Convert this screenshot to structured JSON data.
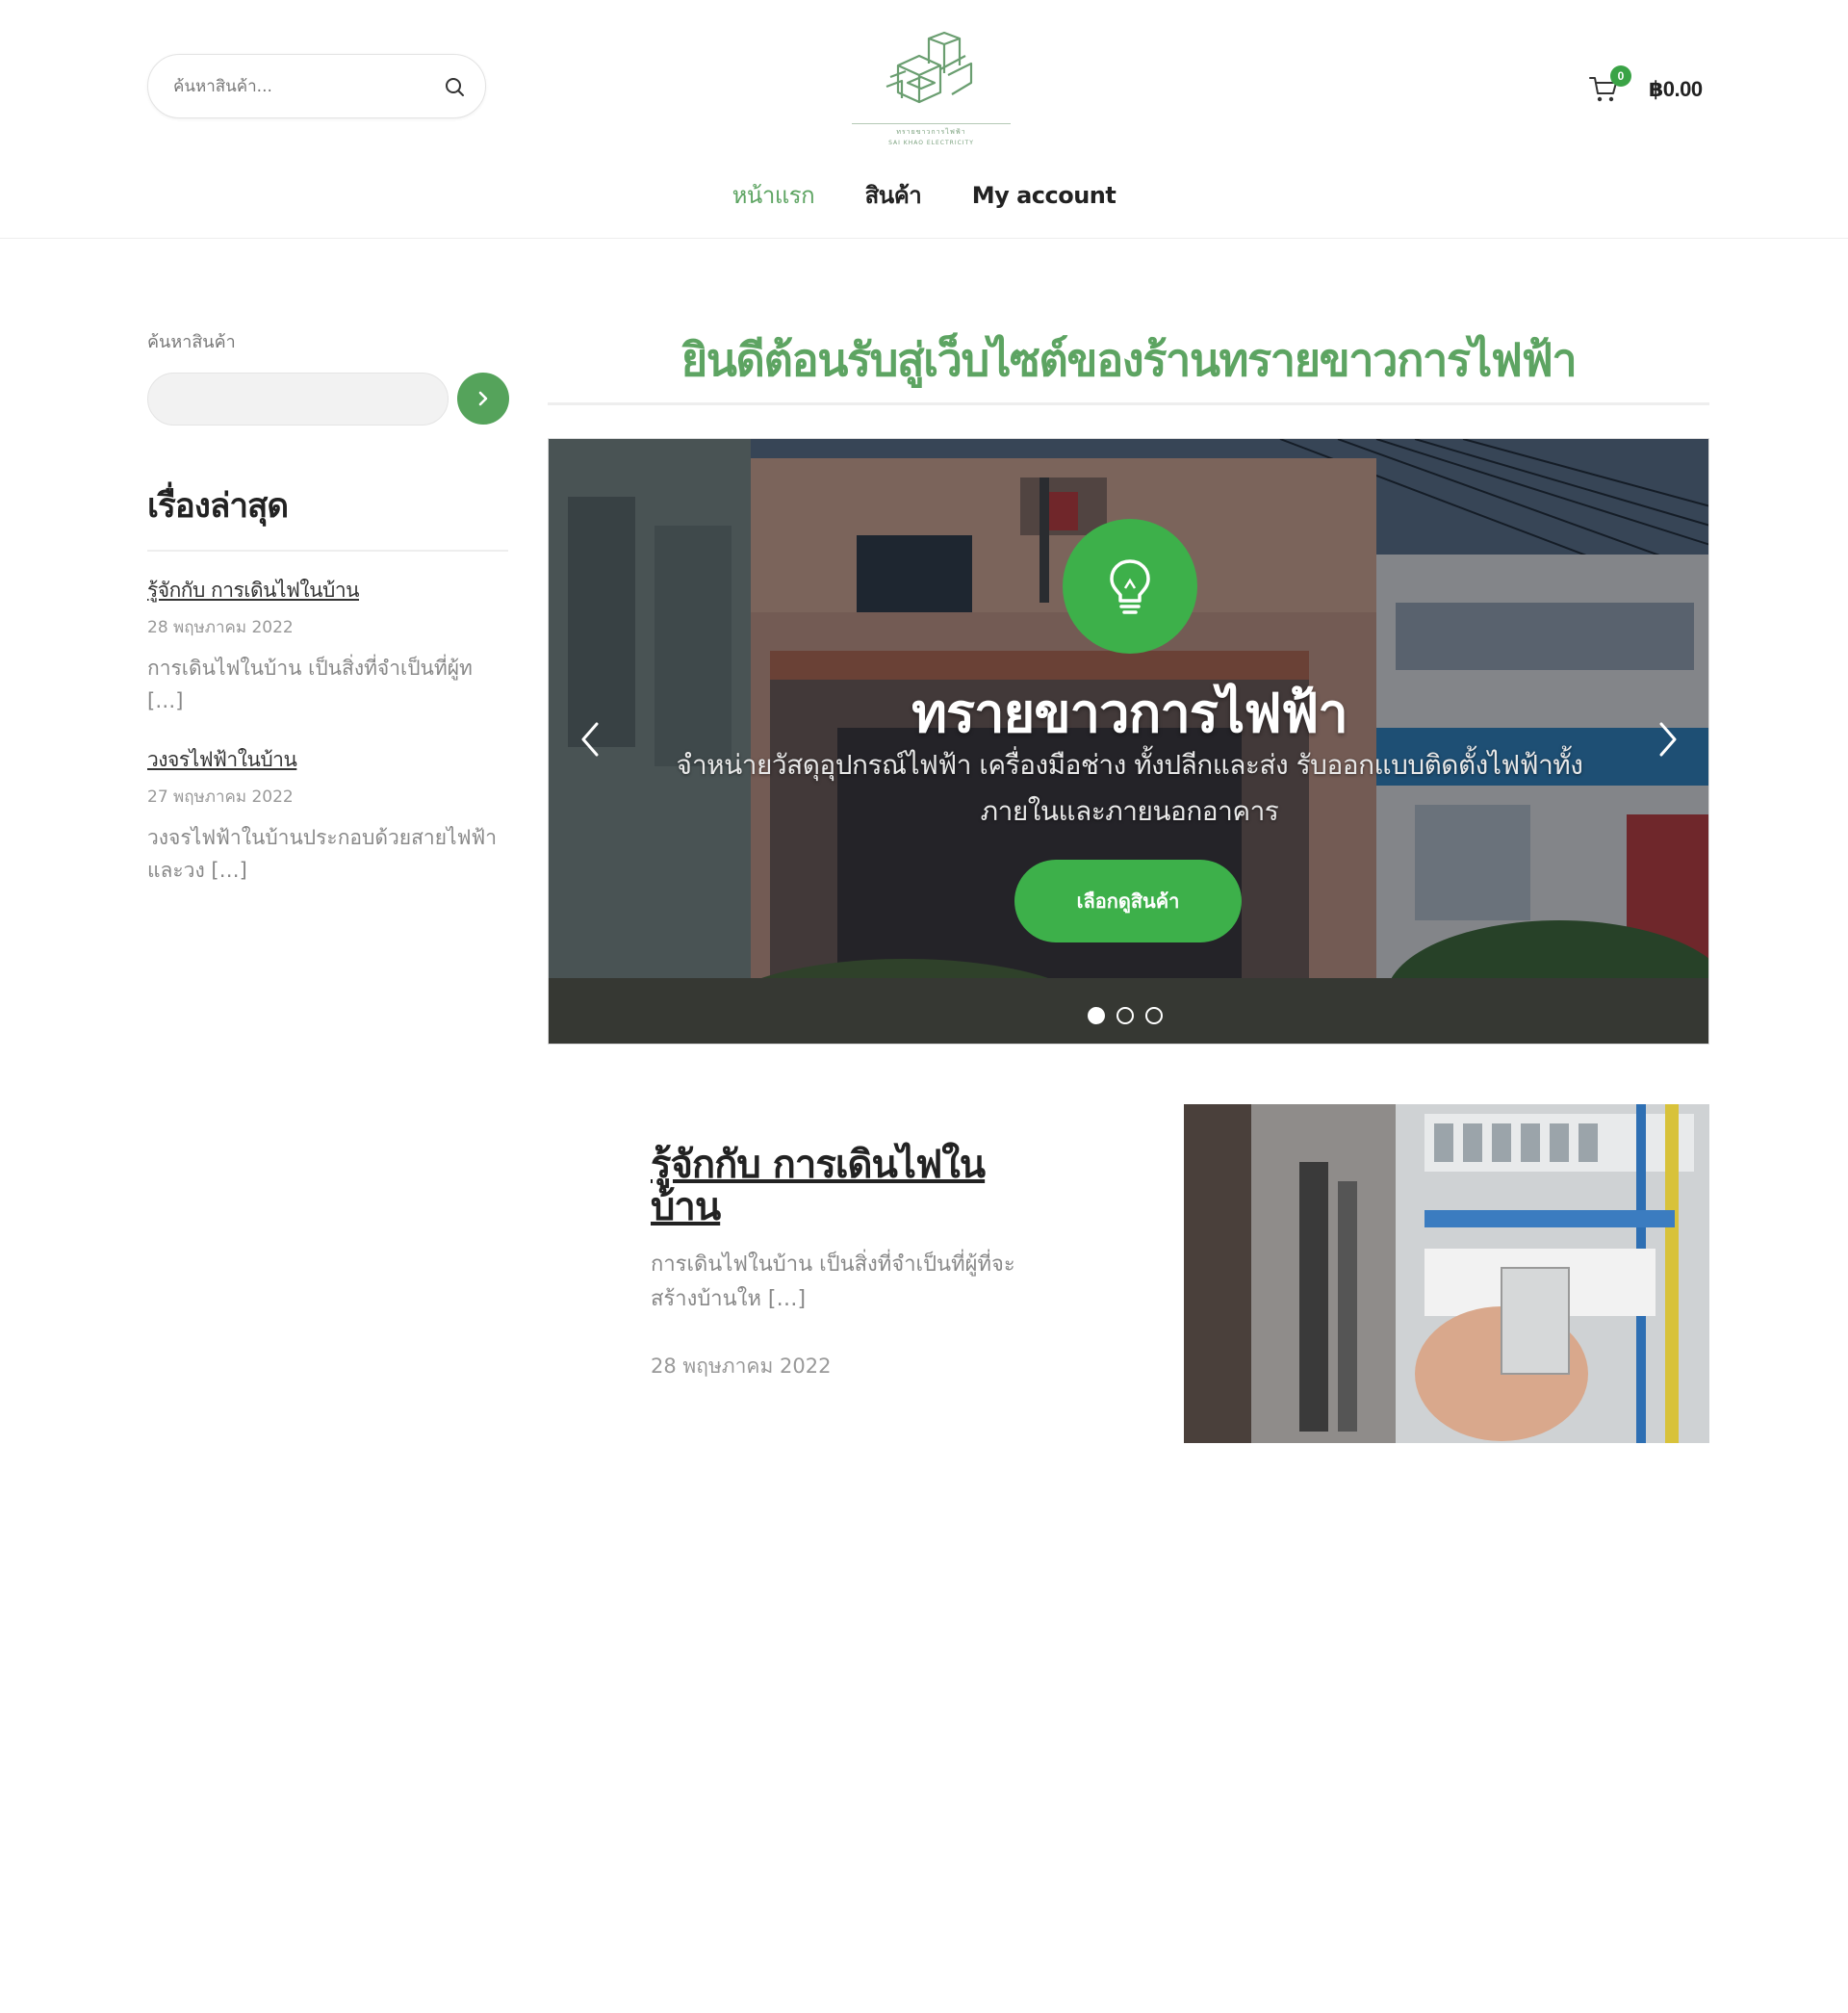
{
  "header": {
    "search_placeholder": "ค้นหาสินค้า...",
    "logo_line1": "ทรายขาวการไฟฟ้า",
    "logo_line2": "SAI KHAO ELECTRICITY",
    "cart_count": "0",
    "cart_total": "฿0.00"
  },
  "nav": {
    "items": [
      {
        "label": "หน้าแรก",
        "active": true
      },
      {
        "label": "สินค้า",
        "active": false
      },
      {
        "label": "My account",
        "active": false
      }
    ]
  },
  "sidebar": {
    "search_label": "ค้นหาสินค้า",
    "recent_heading": "เรื่องล่าสุด",
    "posts": [
      {
        "title": "รู้จักกับ การเดินไฟในบ้าน",
        "date": "28 พฤษภาคม 2022",
        "excerpt": "การเดินไฟในบ้าน เป็นสิ่งที่จำเป็นที่ผู้ท […]"
      },
      {
        "title": "วงจรไฟฟ้าในบ้าน",
        "date": "27 พฤษภาคม 2022",
        "excerpt": "วงจรไฟฟ้าในบ้านประกอบด้วยสายไฟฟ้า และวง […]"
      }
    ]
  },
  "main": {
    "page_title": "ยินดีต้อนรับสู่เว็บไซต์ของร้านทรายขาวการไฟฟ้า",
    "slider": {
      "icon": "lightbulb-icon",
      "title": "ทรายขาวการไฟฟ้า",
      "description": "จำหน่ายวัสดุอุปกรณ์ไฟฟ้า เครื่องมือช่าง ทั้งปลีกและส่ง รับออกแบบติดตั้งไฟฟ้าทั้งภายในและภายนอกอาคาร",
      "button_label": "เลือกดูสินค้า",
      "slide_count": 3,
      "active_slide": 1
    },
    "featured": {
      "title": "รู้จักกับ การเดินไฟในบ้าน",
      "excerpt": "การเดินไฟในบ้าน เป็นสิ่งที่จำเป็นที่ผู้ที่จะสร้างบ้านให […]",
      "date": "28 พฤษภาคม 2022"
    }
  },
  "colors": {
    "accent_green": "#5da462",
    "button_green": "#3db04a"
  }
}
